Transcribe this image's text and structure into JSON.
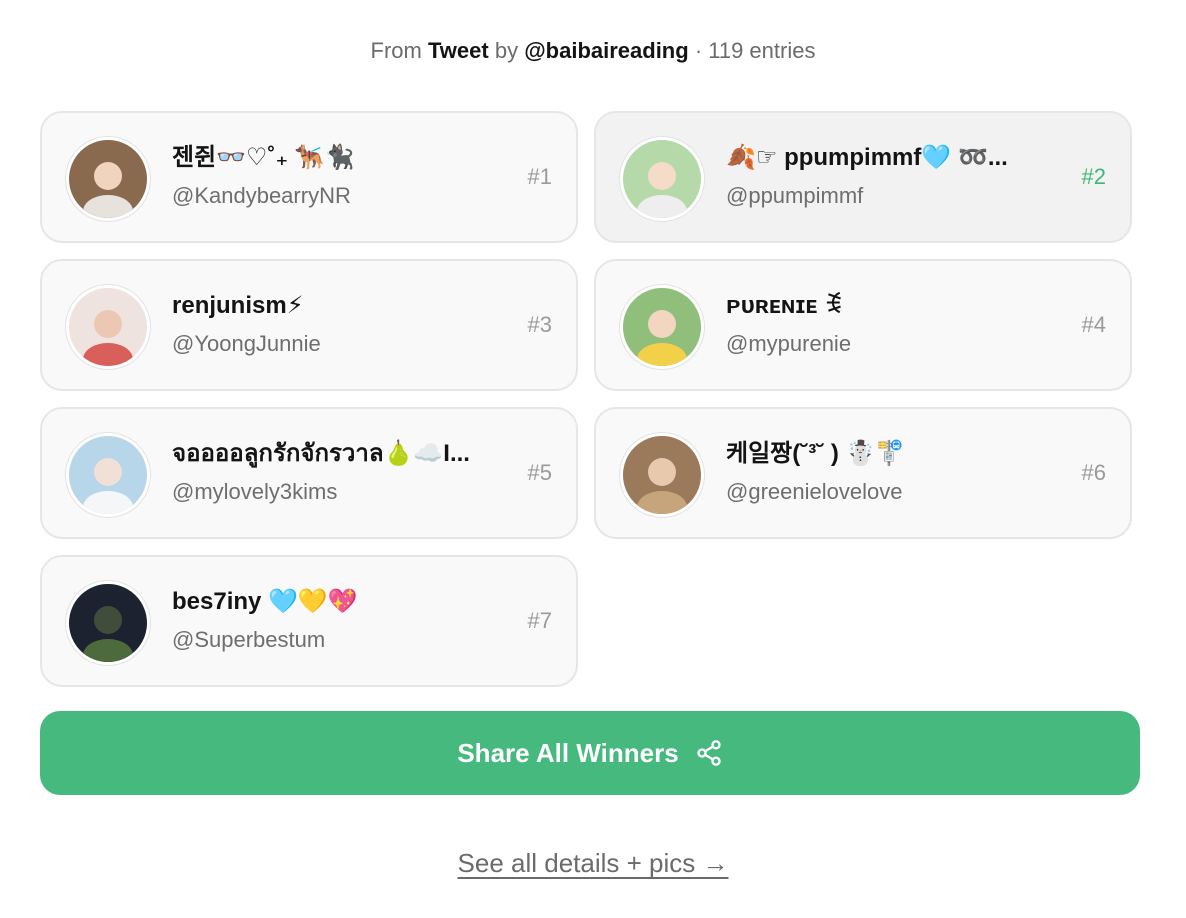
{
  "header": {
    "from_label": "From",
    "source": "Tweet",
    "by_label": "by",
    "author": "@baibaireading",
    "entries": "· 119 entries"
  },
  "winners": [
    {
      "name": "젠쥔👓♡˚₊ 🐕‍🦺🐈‍⬛",
      "handle": "@KandybearryNR",
      "rank": "#1"
    },
    {
      "name": "🍂☞ ppumpimmf🩵 ➿...",
      "handle": "@ppumpimmf",
      "rank": "#2"
    },
    {
      "name": "renjunism⚡",
      "handle": "@YoongJunnie",
      "rank": "#3"
    },
    {
      "name": "ᴘᴜʀᴇɴɪᴇ ꉂ",
      "handle": "@mypurenie",
      "rank": "#4"
    },
    {
      "name": "จออออลูกรักจักรวาล🍐☁️I...",
      "handle": "@mylovely3kims",
      "rank": "#5"
    },
    {
      "name": "케일짱(˘³˘ ) ☃️🚏",
      "handle": "@greenielovelove",
      "rank": "#6"
    },
    {
      "name": "bes7iny 🩵💛💖",
      "handle": "@Superbestum",
      "rank": "#7"
    }
  ],
  "share_button": {
    "label": "Share All Winners",
    "icon": "share-icon"
  },
  "details_link": {
    "label": "See all details + pics →"
  },
  "colors": {
    "accent": "#45b97e",
    "rank_highlight": "#3fb77a"
  }
}
